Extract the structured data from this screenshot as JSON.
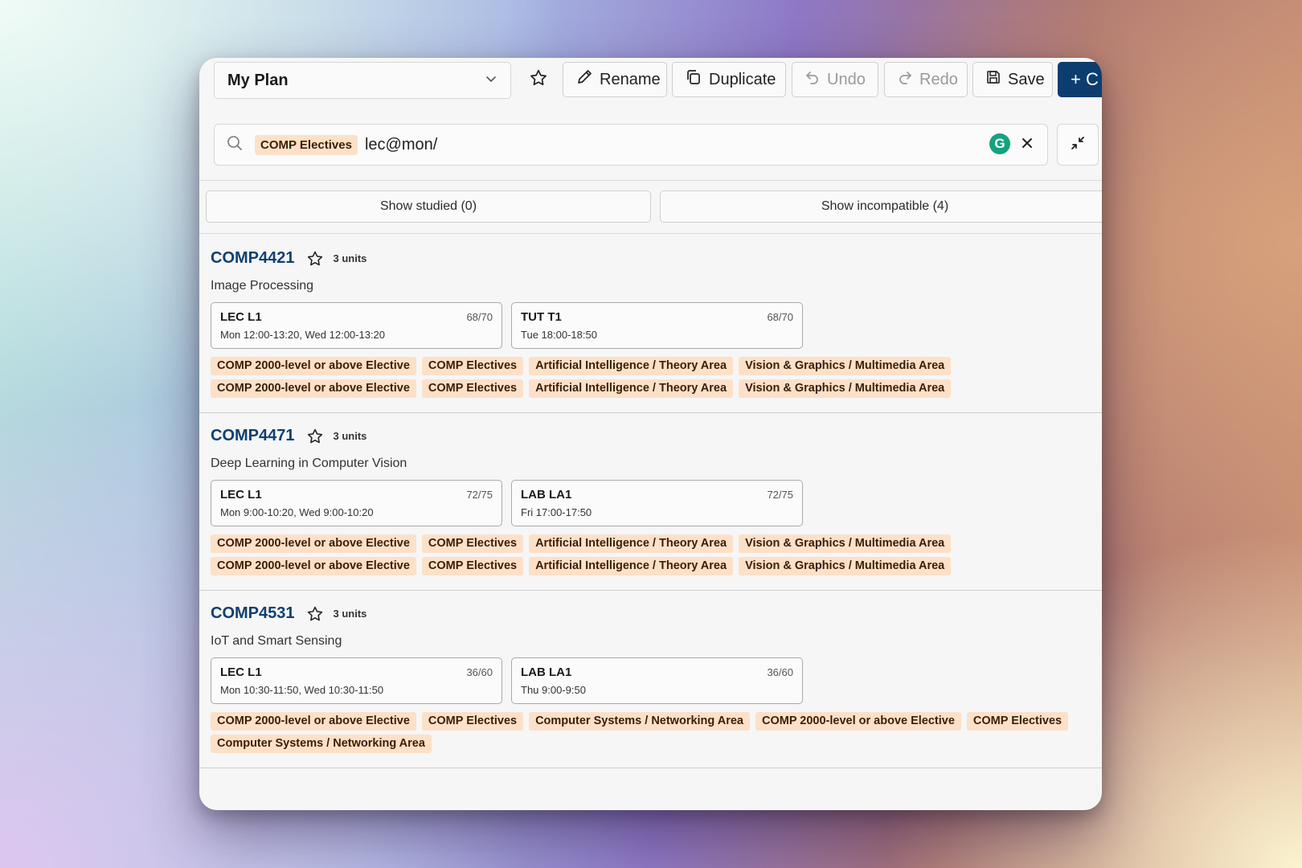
{
  "toolbar": {
    "plan_name": "My Plan",
    "rename_label": "Rename",
    "duplicate_label": "Duplicate",
    "undo_label": "Undo",
    "redo_label": "Redo",
    "save_label": "Save",
    "create_label": "+ C"
  },
  "search": {
    "filter_chip": "COMP Electives",
    "query": "lec@mon/",
    "grammarly_glyph": "G"
  },
  "filters": {
    "show_studied": "Show studied (0)",
    "show_incompatible": "Show incompatible (4)"
  },
  "courses": [
    {
      "code": "COMP4421",
      "units": "3 units",
      "title": "Image Processing",
      "sections": [
        {
          "name": "LEC L1",
          "capacity": "68/70",
          "time": "Mon 12:00-13:20, Wed 12:00-13:20"
        },
        {
          "name": "TUT T1",
          "capacity": "68/70",
          "time": "Tue 18:00-18:50"
        }
      ],
      "tags": [
        "COMP 2000-level or above Elective",
        "COMP Electives",
        "Artificial Intelligence / Theory Area",
        "Vision & Graphics / Multimedia Area",
        "COMP 2000-level or above Elective",
        "COMP Electives",
        "Artificial Intelligence / Theory Area",
        "Vision & Graphics / Multimedia Area"
      ]
    },
    {
      "code": "COMP4471",
      "units": "3 units",
      "title": "Deep Learning in Computer Vision",
      "sections": [
        {
          "name": "LEC L1",
          "capacity": "72/75",
          "time": "Mon 9:00-10:20, Wed 9:00-10:20"
        },
        {
          "name": "LAB LA1",
          "capacity": "72/75",
          "time": "Fri 17:00-17:50"
        }
      ],
      "tags": [
        "COMP 2000-level or above Elective",
        "COMP Electives",
        "Artificial Intelligence / Theory Area",
        "Vision & Graphics / Multimedia Area",
        "COMP 2000-level or above Elective",
        "COMP Electives",
        "Artificial Intelligence / Theory Area",
        "Vision & Graphics / Multimedia Area"
      ]
    },
    {
      "code": "COMP4531",
      "units": "3 units",
      "title": "IoT and Smart Sensing",
      "sections": [
        {
          "name": "LEC L1",
          "capacity": "36/60",
          "time": "Mon 10:30-11:50, Wed 10:30-11:50"
        },
        {
          "name": "LAB LA1",
          "capacity": "36/60",
          "time": "Thu 9:00-9:50"
        }
      ],
      "tags": [
        "COMP 2000-level or above Elective",
        "COMP Electives",
        "Computer Systems / Networking Area",
        "COMP 2000-level or above Elective",
        "COMP Electives",
        "Computer Systems / Networking Area"
      ]
    }
  ],
  "colors": {
    "accent_navy": "#0c3d6e",
    "course_code": "#0f3f73",
    "tag_bg": "#fde0c8",
    "tag_text": "#3a1e05"
  }
}
